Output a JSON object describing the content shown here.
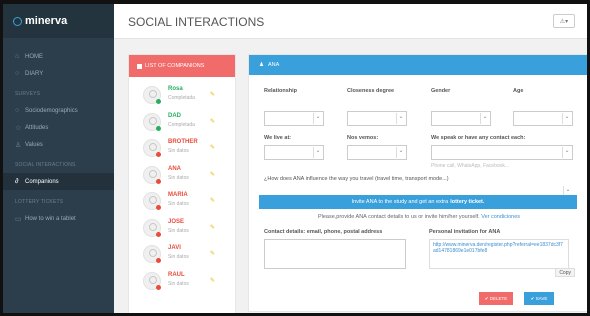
{
  "app": {
    "brand": "minerva",
    "page_title": "SOCIAL INTERACTIONS",
    "user_menu": "⚠▾"
  },
  "sidebar": {
    "items": [
      {
        "label": "HOME",
        "icon": "home-icon",
        "glyph": "⌂"
      },
      {
        "label": "DIARY",
        "icon": "diary-icon",
        "glyph": "○"
      }
    ],
    "section_surveys": "SURVEYS",
    "surveys": [
      {
        "label": "Sociodemographics",
        "icon": "person-icon",
        "glyph": "○"
      },
      {
        "label": "Attitudes",
        "icon": "star-icon",
        "glyph": "☆"
      },
      {
        "label": "Values",
        "icon": "scale-icon",
        "glyph": "♙"
      }
    ],
    "section_social": "SOCIAL INTERACTIONS",
    "social": [
      {
        "label": "Companions",
        "icon": "companions-icon",
        "glyph": "∂"
      }
    ],
    "section_lottery": "LOTTERY TICKETS",
    "lottery": [
      {
        "label": "How to win a tablet",
        "icon": "tablet-icon",
        "glyph": "▭"
      }
    ]
  },
  "companions": {
    "header": "LIST OF COMPANIONS",
    "items": [
      {
        "name": "Rosa",
        "status": "Completada",
        "name_color": "#27ae60",
        "dot_color": "#27ae60"
      },
      {
        "name": "DAD",
        "status": "Completada",
        "name_color": "#27ae60",
        "dot_color": "#27ae60"
      },
      {
        "name": "BROTHER",
        "status": "Sin datos",
        "name_color": "#e74c3c",
        "dot_color": "#e74c3c"
      },
      {
        "name": "ANA",
        "status": "Sin datos",
        "name_color": "#e74c3c",
        "dot_color": "#e74c3c"
      },
      {
        "name": "MARIA",
        "status": "Sin datos",
        "name_color": "#e74c3c",
        "dot_color": "#e74c3c"
      },
      {
        "name": "JOSE",
        "status": "Sin datos",
        "name_color": "#e74c3c",
        "dot_color": "#e74c3c"
      },
      {
        "name": "JAVI",
        "status": "Sin datos",
        "name_color": "#e74c3c",
        "dot_color": "#e74c3c"
      },
      {
        "name": "RAUL",
        "status": "Sin datos",
        "name_color": "#e74c3c",
        "dot_color": "#e74c3c"
      }
    ]
  },
  "form": {
    "header": "ANA",
    "relationship_label": "Relationship",
    "closeness_label": "Closeness degree",
    "gender_label": "Gender",
    "age_label": "Age",
    "live_label": "We live at:",
    "meet_label": "Nos vemos:",
    "contact_label": "We speak or have any contact each:",
    "contact_placeholder": "Phone call, WhatsApp, Facebook...",
    "influence_label": "¿How does ANA influence the way you travel (travel time, transport mode...)",
    "invite_text": "Invite ANA to the study and get an extra",
    "invite_bold": "lottery ticket.",
    "provide_text": "Please,provide ANA contact details to us or invite him/her yourself.",
    "provide_link": "Ver condiciones",
    "details_label": "Contact details: email, phone, postal address",
    "invitation_label": "Personal invitation for ANA",
    "invitation_url": "http://www.minerva.den/register.php?referral=ee1837dc3f7ad14781869e1e017bfe8",
    "copy_label": "Copy",
    "delete_label": "✔ DELETE",
    "save_label": "✔ SAVE"
  },
  "colors": {
    "sidebar": "#2c3e4c",
    "accent_red": "#f26b6b",
    "accent_blue": "#3aa0dc",
    "complete": "#27ae60",
    "incomplete": "#e74c3c"
  }
}
